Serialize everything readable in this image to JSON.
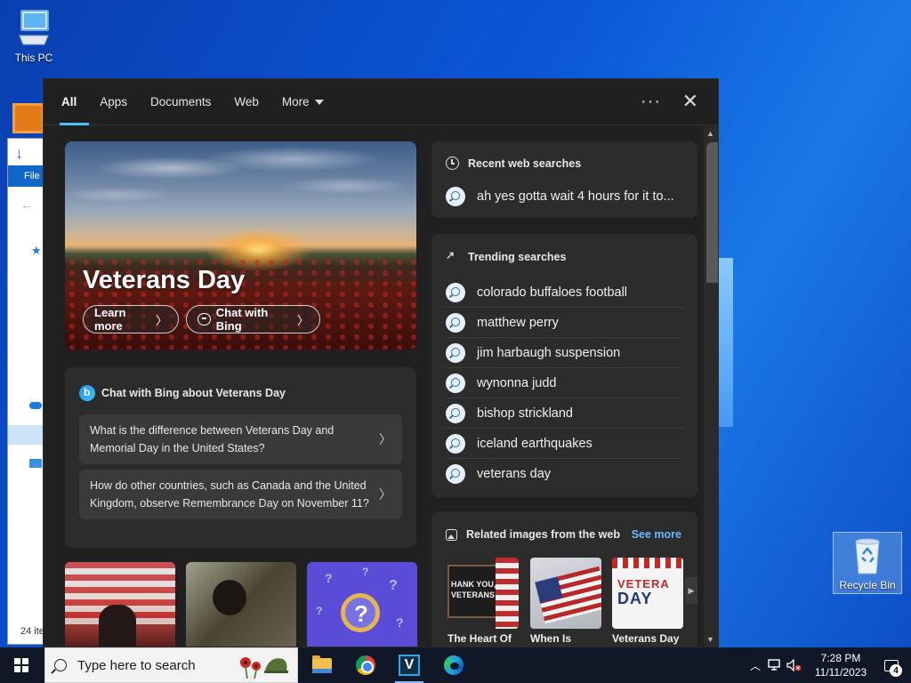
{
  "desktop": {
    "this_pc_label": "This PC",
    "recycle_bin_label": "Recycle Bin"
  },
  "explorer": {
    "file_tab": "File",
    "items_count": "24 ite"
  },
  "search_panel": {
    "tabs": [
      {
        "label": "All",
        "active": true
      },
      {
        "label": "Apps"
      },
      {
        "label": "Documents"
      },
      {
        "label": "Web"
      },
      {
        "label": "More"
      }
    ],
    "hero": {
      "title": "Veterans Day",
      "learn_more": "Learn more",
      "chat_with_bing": "Chat with Bing"
    },
    "chat_card": {
      "title": "Chat with Bing about Veterans Day",
      "questions": [
        "What is the difference between Veterans Day and Memorial Day in the United States?",
        "How do other countries, such as Canada and the United Kingdom, observe Remembrance Day on November 11?"
      ]
    },
    "recent": {
      "title": "Recent web searches",
      "items": [
        "ah yes gotta wait 4 hours for it to..."
      ]
    },
    "trending": {
      "title": "Trending searches",
      "items": [
        "colorado buffaloes football",
        "matthew perry",
        "jim harbaugh suspension",
        "wynonna judd",
        "bishop strickland",
        "iceland earthquakes",
        "veterans day"
      ]
    },
    "related": {
      "title": "Related images from the web",
      "see_more": "See more",
      "captions": [
        "The Heart Of",
        "When Is",
        "Veterans Day"
      ],
      "image_texts": {
        "chalkboard": "HANK YOU,\nVETERANS",
        "poster_line1": "VETERA",
        "poster_line2": "DAY"
      }
    }
  },
  "taskbar": {
    "search_placeholder": "Type here to search",
    "vapp_letter": "V",
    "time": "7:28 PM",
    "date": "11/11/2023",
    "notification_count": "4"
  }
}
